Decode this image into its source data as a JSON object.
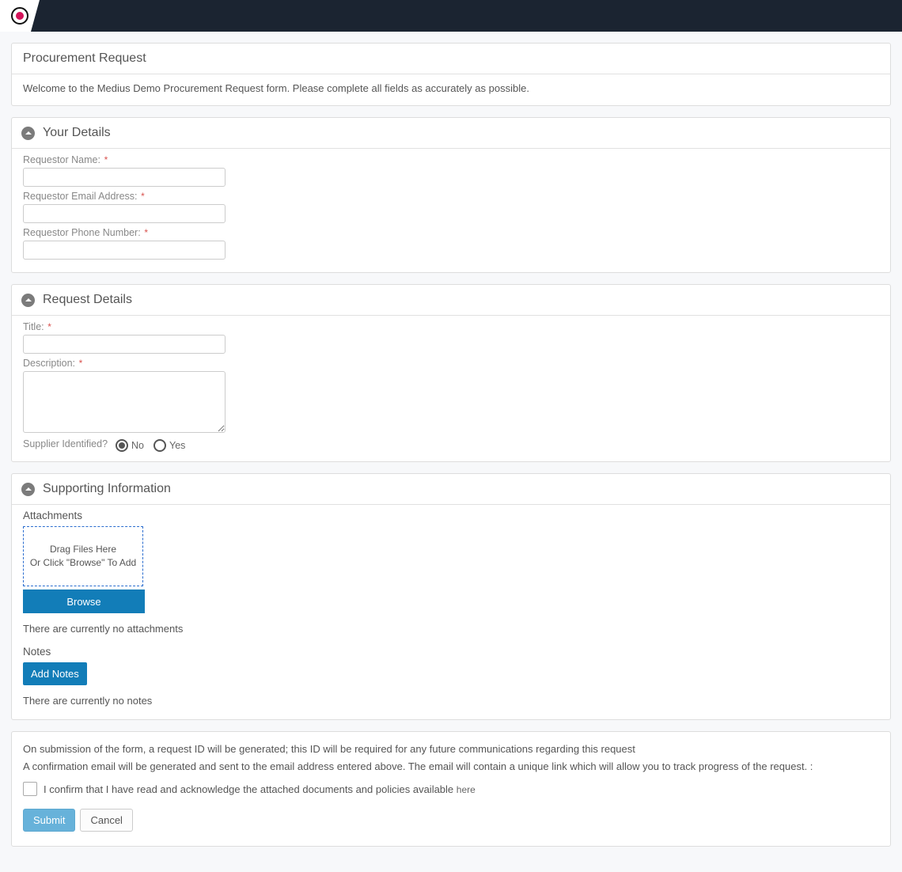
{
  "intro": {
    "title": "Procurement Request",
    "welcome": "Welcome to the Medius Demo Procurement Request form. Please complete all fields as accurately as possible."
  },
  "sections": {
    "your_details": {
      "title": "Your Details",
      "fields": {
        "name_label": "Requestor Name:",
        "name_value": "",
        "email_label": "Requestor Email Address:",
        "email_value": "",
        "phone_label": "Requestor Phone Number:",
        "phone_value": ""
      }
    },
    "request_details": {
      "title": "Request Details",
      "fields": {
        "title_label": "Title:",
        "title_value": "",
        "desc_label": "Description:",
        "desc_value": "",
        "supplier_label": "Supplier Identified?",
        "option_no": "No",
        "option_yes": "Yes",
        "selected": "No"
      }
    },
    "supporting": {
      "title": "Supporting Information",
      "attachments_label": "Attachments",
      "drop_line1": "Drag Files Here",
      "drop_line2": "Or Click \"Browse\" To Add",
      "browse_btn": "Browse",
      "no_attachments": "There are currently no attachments",
      "notes_label": "Notes",
      "add_notes_btn": "Add Notes",
      "no_notes": "There are currently no notes"
    }
  },
  "footer": {
    "line1": "On submission of the form, a request ID will be generated; this ID will be required for any future communications regarding this request",
    "line2": "A confirmation email will be generated and sent to the email address entered above. The email will contain a unique link which will allow you to track progress of the request. :",
    "confirm_text": "I confirm that I have read and acknowledge the attached documents and policies available ",
    "here_link": "here",
    "submit_btn": "Submit",
    "cancel_btn": "Cancel"
  }
}
